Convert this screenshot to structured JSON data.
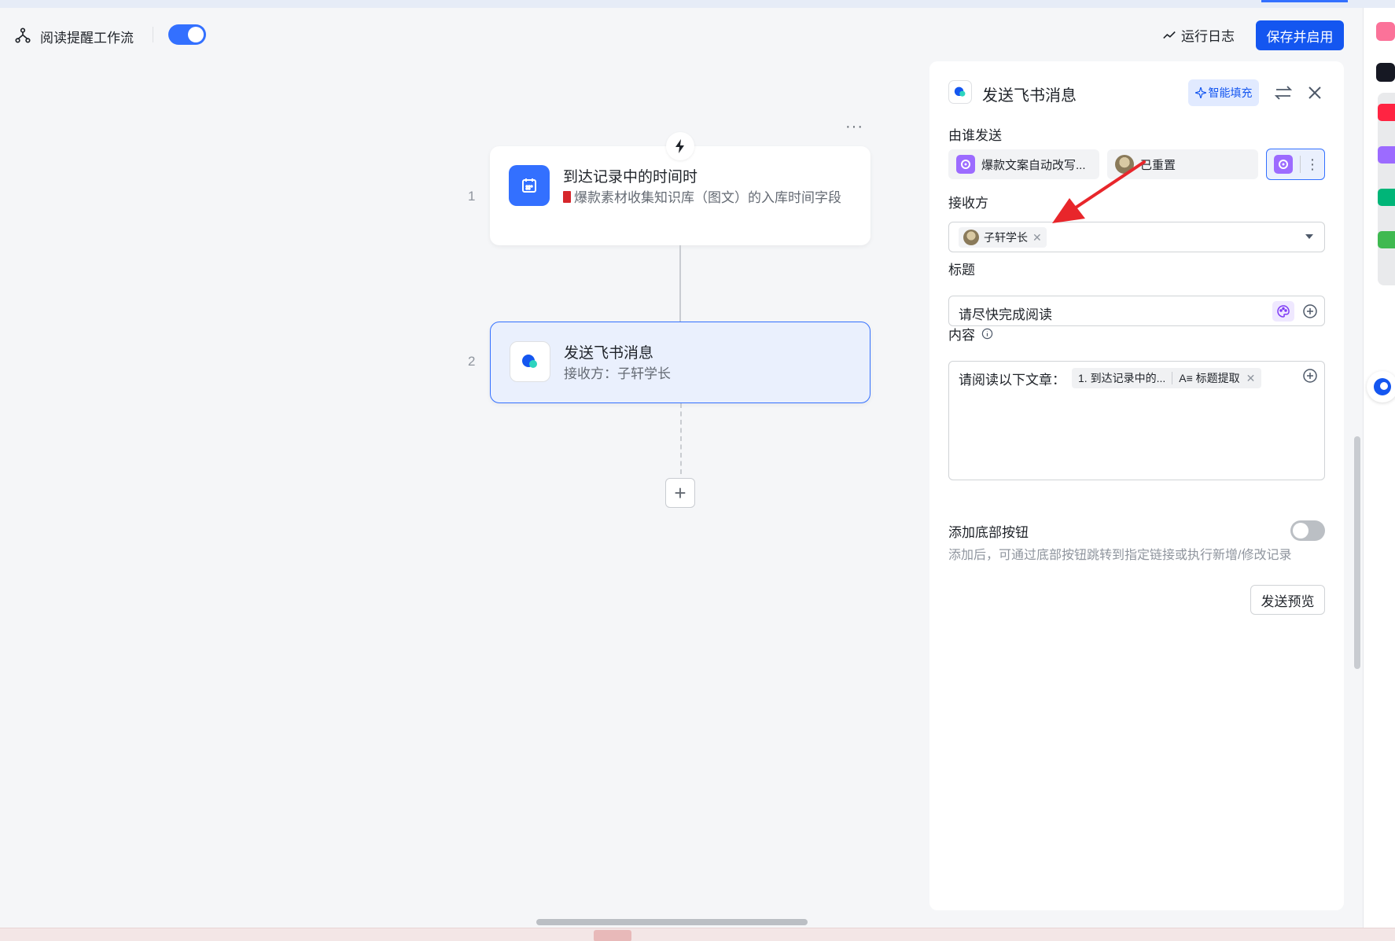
{
  "header": {
    "workflow_title": "阅读提醒工作流",
    "run_log_label": "运行日志",
    "save_button_label": "保存并启用"
  },
  "flow": {
    "steps": [
      {
        "number": "1",
        "title": "到达记录中的时间时",
        "subtitle": "爆款素材收集知识库（图文）的入库时间字段",
        "icon": "calendar-icon"
      },
      {
        "number": "2",
        "title": "发送飞书消息",
        "subtitle": "接收方：子轩学长",
        "icon": "feishu-message-icon"
      }
    ],
    "more_label": "···",
    "add_label": "+"
  },
  "panel": {
    "title": "发送飞书消息",
    "smart_fill_label": "智能填充",
    "sender": {
      "label": "由谁发送",
      "options": [
        {
          "name": "爆款文案自动改写..."
        },
        {
          "name": "已重置"
        }
      ]
    },
    "receiver": {
      "label": "接收方",
      "tags": [
        "子轩学长"
      ]
    },
    "title_field": {
      "label": "标题",
      "value": "请尽快完成阅读"
    },
    "content_field": {
      "label": "内容",
      "text": "请阅读以下文章：",
      "var_chip": {
        "source": "1. 到达记录中的...",
        "field": "A≡ 标题提取"
      }
    },
    "bottom_button": {
      "label": "添加底部按钮",
      "hint": "添加后，可通过底部按钮跳转到指定链接或执行新增/修改记录",
      "enabled": false
    },
    "preview_label": "发送预览"
  },
  "colors": {
    "primary": "#1456f0",
    "accent": "#3370ff",
    "annotation_arrow": "#e8262b"
  }
}
